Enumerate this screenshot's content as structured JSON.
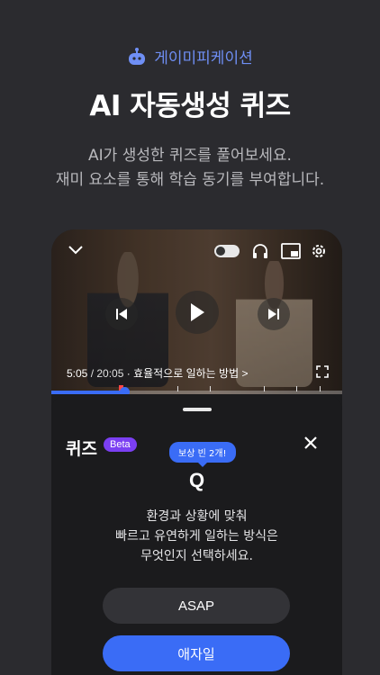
{
  "header": {
    "badge_label": "게이미피케이션",
    "headline": "AI 자동생성 퀴즈",
    "sub_line1": "AI가 생성한 퀴즈를 풀어보세요.",
    "sub_line2": "재미 요소를 통해 학습 동기를 부여합니다."
  },
  "colors": {
    "background": "#2b2b2f",
    "accent": "#3a6cf6",
    "badge_text": "#6f8ff5",
    "beta": "#7b3ff2"
  },
  "player": {
    "current_time": "5:05",
    "total_time": " / 20:05",
    "chapter": "· 효율적으로 일하는 방법 >",
    "progress_fraction": 0.25
  },
  "quiz": {
    "title": "퀴즈",
    "beta_label": "Beta",
    "reward_tooltip": "보상 빈 2개!",
    "q_label": "Q",
    "question_line1": "환경과 상황에 맞춰",
    "question_line2": "빠르고 유연하게 일하는 방식은",
    "question_line3": "무엇인지 선택하세요.",
    "options": [
      "ASAP",
      "애자일"
    ]
  },
  "icons": [
    "robot-icon",
    "chevron-down-icon",
    "toggle-icon",
    "headphones-icon",
    "pip-icon",
    "gear-icon",
    "skip-back-icon",
    "play-icon",
    "skip-forward-icon",
    "fullscreen-icon",
    "close-icon"
  ]
}
